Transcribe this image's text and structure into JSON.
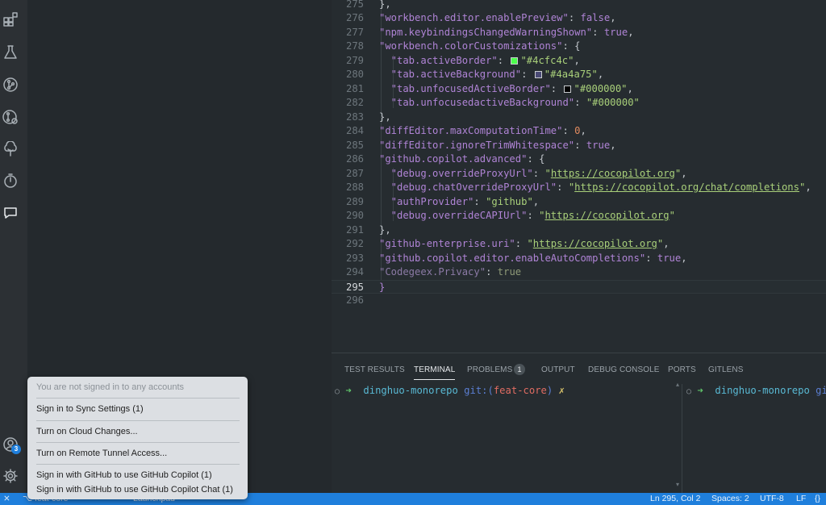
{
  "editor": {
    "lines": [
      {
        "n": "275",
        "parts": [
          [
            "pun",
            "},"
          ]
        ]
      },
      {
        "n": "276",
        "parts": [
          [
            "sk",
            "\"workbench.editor.enablePreview\""
          ],
          [
            "pun",
            ": "
          ],
          [
            "kw",
            "false"
          ],
          [
            "pun",
            ","
          ]
        ]
      },
      {
        "n": "277",
        "parts": [
          [
            "sk",
            "\"npm.keybindingsChangedWarningShown\""
          ],
          [
            "pun",
            ": "
          ],
          [
            "kw",
            "true"
          ],
          [
            "pun",
            ","
          ]
        ]
      },
      {
        "n": "278",
        "parts": [
          [
            "sk",
            "\"workbench.colorCustomizations\""
          ],
          [
            "pun",
            ": {"
          ]
        ]
      },
      {
        "n": "279",
        "parts": [
          [
            "sk",
            "  \"tab.activeBorder\""
          ],
          [
            "pun",
            ": "
          ],
          [
            "swatch",
            "#4cfc4c"
          ],
          [
            "sv",
            "\"#4cfc4c\""
          ],
          [
            "pun",
            ","
          ]
        ]
      },
      {
        "n": "280",
        "parts": [
          [
            "sk",
            "  \"tab.activeBackground\""
          ],
          [
            "pun",
            ": "
          ],
          [
            "swatch",
            "#4a4a75"
          ],
          [
            "sv",
            "\"#4a4a75\""
          ],
          [
            "pun",
            ","
          ]
        ]
      },
      {
        "n": "281",
        "parts": [
          [
            "sk",
            "  \"tab.unfocusedActiveBorder\""
          ],
          [
            "pun",
            ": "
          ],
          [
            "swatch",
            "#000000"
          ],
          [
            "sv",
            "\"#000000\""
          ],
          [
            "pun",
            ","
          ]
        ]
      },
      {
        "n": "282",
        "parts": [
          [
            "sk",
            "  \"tab.unfocusedactiveBackground\""
          ],
          [
            "pun",
            ": "
          ],
          [
            "sv",
            "\"#000000\""
          ]
        ]
      },
      {
        "n": "283",
        "parts": [
          [
            "pun",
            "},"
          ]
        ]
      },
      {
        "n": "284",
        "parts": [
          [
            "sk",
            "\"diffEditor.maxComputationTime\""
          ],
          [
            "pun",
            ": "
          ],
          [
            "num",
            "0"
          ],
          [
            "pun",
            ","
          ]
        ]
      },
      {
        "n": "285",
        "parts": [
          [
            "sk",
            "\"diffEditor.ignoreTrimWhitespace\""
          ],
          [
            "pun",
            ": "
          ],
          [
            "kw",
            "true"
          ],
          [
            "pun",
            ","
          ]
        ]
      },
      {
        "n": "286",
        "parts": [
          [
            "sk",
            "\"github.copilot.advanced\""
          ],
          [
            "pun",
            ": {"
          ]
        ]
      },
      {
        "n": "287",
        "parts": [
          [
            "sk",
            "  \"debug.overrideProxyUrl\""
          ],
          [
            "pun",
            ": "
          ],
          [
            "sv",
            "\""
          ],
          [
            "svl",
            "https://cocopilot.org"
          ],
          [
            "sv",
            "\""
          ],
          [
            "pun",
            ","
          ]
        ]
      },
      {
        "n": "288",
        "parts": [
          [
            "sk",
            "  \"debug.chatOverrideProxyUrl\""
          ],
          [
            "pun",
            ": "
          ],
          [
            "sv",
            "\""
          ],
          [
            "svl",
            "https://cocopilot.org/chat/completions"
          ],
          [
            "sv",
            "\""
          ],
          [
            "pun",
            ","
          ]
        ]
      },
      {
        "n": "289",
        "parts": [
          [
            "sk",
            "  \"authProvider\""
          ],
          [
            "pun",
            ": "
          ],
          [
            "sv",
            "\"github\""
          ],
          [
            "pun",
            ","
          ]
        ]
      },
      {
        "n": "290",
        "parts": [
          [
            "sk",
            "  \"debug.overrideCAPIUrl\""
          ],
          [
            "pun",
            ": "
          ],
          [
            "sv",
            "\""
          ],
          [
            "svl",
            "https://cocopilot.org"
          ],
          [
            "sv",
            "\""
          ]
        ]
      },
      {
        "n": "291",
        "parts": [
          [
            "pun",
            "},"
          ]
        ]
      },
      {
        "n": "292",
        "parts": [
          [
            "sk",
            "\"github-enterprise.uri\""
          ],
          [
            "pun",
            ": "
          ],
          [
            "sv",
            "\""
          ],
          [
            "svl",
            "https://cocopilot.org"
          ],
          [
            "sv",
            "\""
          ],
          [
            "pun",
            ","
          ]
        ]
      },
      {
        "n": "293",
        "parts": [
          [
            "sk",
            "\"github.copilot.editor.enableAutoCompletions\""
          ],
          [
            "pun",
            ": "
          ],
          [
            "kw",
            "true"
          ],
          [
            "pun",
            ","
          ]
        ]
      },
      {
        "n": "294",
        "parts": [
          [
            "dim",
            "\"Codegeex.Privacy\""
          ],
          [
            "dim2",
            ": "
          ],
          [
            "dimv",
            "true"
          ]
        ]
      },
      {
        "n": "295",
        "parts": [
          [
            "bracket",
            "}"
          ]
        ]
      },
      {
        "n": "296",
        "parts": []
      }
    ],
    "current_line": "295"
  },
  "panel": {
    "tabs": [
      {
        "label": "TEST RESULTS",
        "active": false
      },
      {
        "label": "TERMINAL",
        "active": true
      },
      {
        "label": "PROBLEMS",
        "active": false
      },
      {
        "label": "OUTPUT",
        "active": false
      },
      {
        "label": "DEBUG CONSOLE",
        "active": false
      },
      {
        "label": "PORTS",
        "active": false
      },
      {
        "label": "GITLENS",
        "active": false
      }
    ],
    "problems_count": "1",
    "terminal_left": {
      "circle": "○",
      "arrow": "➜",
      "dir": "dinghuo-monorepo",
      "git": "git:(",
      "branch": "feat-core",
      "close": ")",
      "mark": "✗"
    },
    "terminal_right": {
      "circle": "○",
      "arrow": "➜",
      "dir": "dinghuo-monorepo",
      "git": "git:("
    }
  },
  "activity": {
    "icons": [
      "explorer-icon",
      "flask-icon",
      "source-control-icon",
      "git-graph-icon",
      "tree-icon",
      "timeline-icon",
      "chat-icon",
      "account-icon",
      "settings-gear-icon"
    ],
    "account_badge": "3"
  },
  "accounts_menu": {
    "header": "You are not signed in to any accounts",
    "items": [
      "Sign in to Sync Settings (1)",
      "Turn on Cloud Changes...",
      "Turn on Remote Tunnel Access...",
      "Sign in with GitHub to use GitHub Copilot (1)",
      "Sign in with GitHub to use GitHub Copilot Chat (1)"
    ]
  },
  "status_bar": {
    "left": [
      "⨯",
      "feat-core",
      "Launchpad"
    ],
    "position": "Ln 295, Col 2",
    "spaces": "Spaces: 2",
    "encoding": "UTF-8",
    "eol": "LF",
    "language": "{}"
  },
  "colors": {
    "accent": "#1f7fdc",
    "status_bar": "#1f7fdc",
    "editor_bg": "#262c30"
  }
}
